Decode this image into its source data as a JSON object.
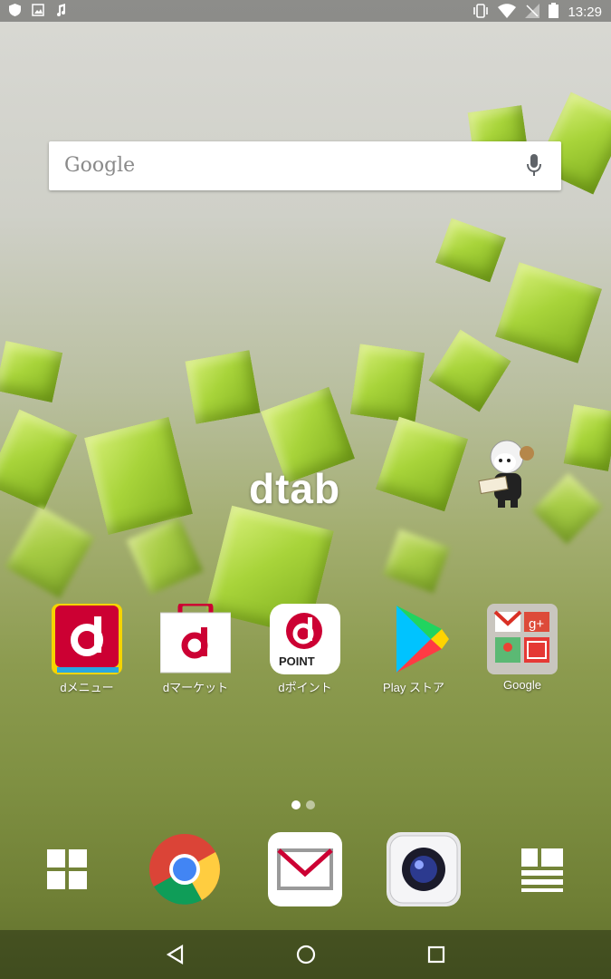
{
  "status_bar": {
    "left_icons": [
      "shield-icon",
      "image-icon",
      "music-icon"
    ],
    "right_icons": [
      "vibrate-icon",
      "wifi-icon",
      "no-signal-icon",
      "battery-icon"
    ],
    "time": "13:29"
  },
  "search": {
    "logo": "Google",
    "mic_icon": "mic-icon"
  },
  "wallpaper": {
    "logo": "dtab",
    "accent": "#a8d43a"
  },
  "apps": [
    {
      "label": "dメニュー",
      "icon": "dmenu-icon"
    },
    {
      "label": "dマーケット",
      "icon": "dmarket-icon"
    },
    {
      "label": "dポイント",
      "icon": "dpoint-icon",
      "badge": "POINT"
    },
    {
      "label": "Play ストア",
      "icon": "play-store-icon"
    },
    {
      "label": "Google",
      "icon": "google-folder-icon"
    }
  ],
  "page_indicator": {
    "pages": 2,
    "current": 1
  },
  "dock": [
    "app-drawer-icon",
    "chrome-icon",
    "mail-icon",
    "camera-icon",
    "news-icon"
  ],
  "nav": [
    "back-icon",
    "home-icon",
    "recents-icon"
  ]
}
